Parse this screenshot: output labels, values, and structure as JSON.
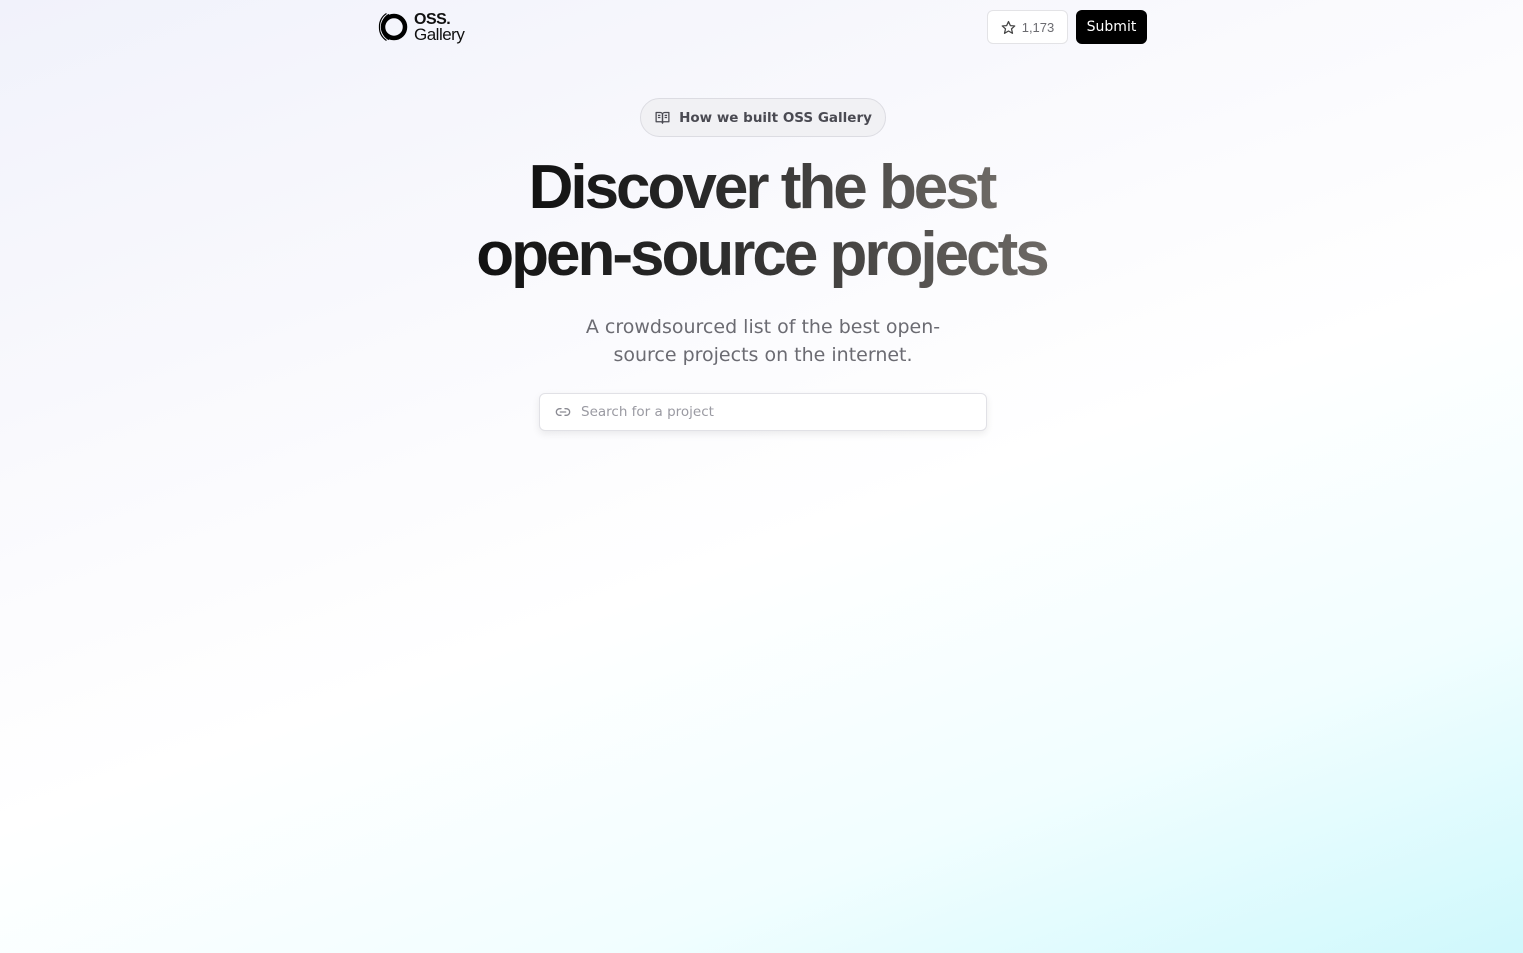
{
  "header": {
    "logo": {
      "line1": "OSS.",
      "line2": "Gallery"
    },
    "star_count": "1,173",
    "submit_label": "Submit"
  },
  "hero": {
    "blog_link_label": "How we built OSS Gallery",
    "headline_line1": "Discover the best",
    "headline_line2": "open-source projects",
    "subtitle": "A crowdsourced list of the best open-source projects on the internet."
  },
  "search": {
    "placeholder": "Search for a project",
    "value": ""
  },
  "colors": {
    "accent_button": "#000000",
    "gradient_end": "#cff8fc"
  },
  "icons": {
    "logo": "oss-gallery-logo",
    "star": "star-icon",
    "blog": "book-open-icon",
    "search": "link-icon"
  }
}
